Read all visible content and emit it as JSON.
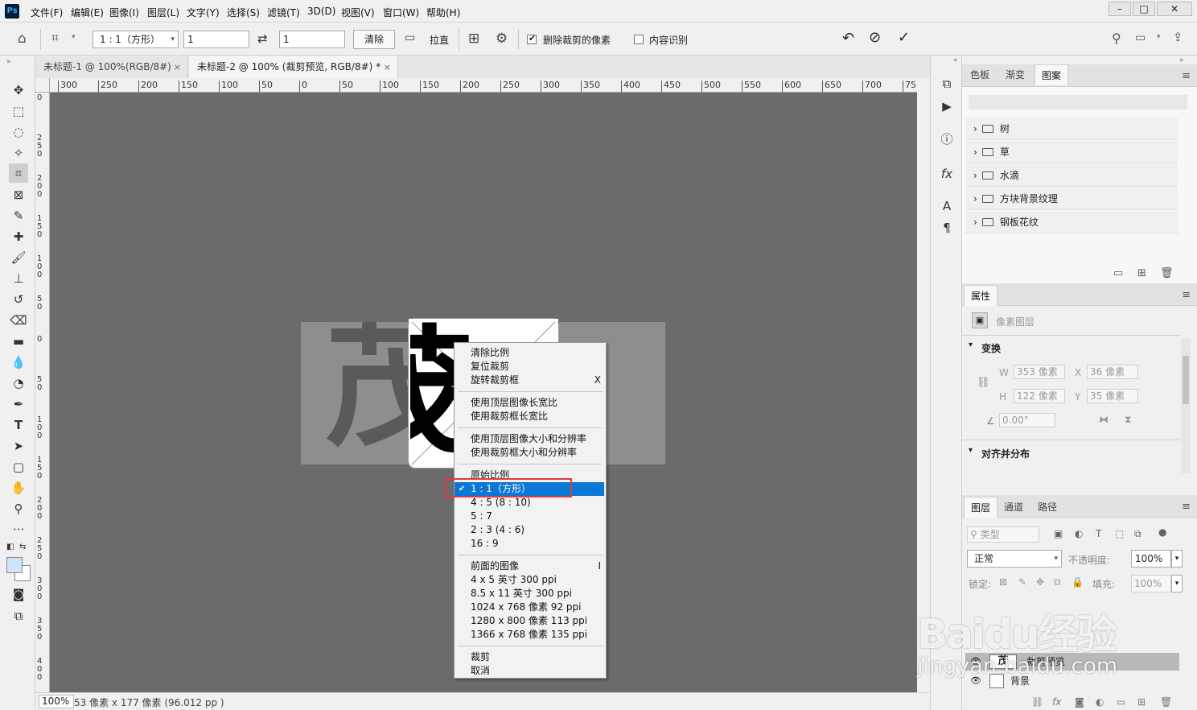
{
  "app": {
    "logo": "Ps"
  },
  "menubar": {
    "items": [
      "文件(F)",
      "编辑(E)",
      "图像(I)",
      "图层(L)",
      "文字(Y)",
      "选择(S)",
      "滤镜(T)",
      "3D(D)",
      "视图(V)",
      "窗口(W)",
      "帮助(H)"
    ]
  },
  "options": {
    "ratio_select": "1 : 1（方形）",
    "width_value": "1",
    "height_value": "1",
    "clear_label": "清除",
    "straighten_label": "拉直",
    "delete_cropped_label": "删除裁剪的像素",
    "delete_cropped_checked": true,
    "content_aware_label": "内容识别",
    "content_aware_checked": false
  },
  "tabs": [
    {
      "label": "未标题-1 @ 100%(RGB/8#)",
      "active": false
    },
    {
      "label": "未标题-2 @ 100% (裁剪预览, RGB/8#) *",
      "active": true
    }
  ],
  "ruler": {
    "h_ticks": [
      "300",
      "250",
      "200",
      "150",
      "100",
      "50",
      "0",
      "50",
      "100",
      "150",
      "200",
      "250",
      "300",
      "350",
      "400",
      "450",
      "500",
      "550",
      "600",
      "650",
      "700",
      "75"
    ],
    "v_ticks": [
      "0",
      "250",
      "200",
      "150",
      "100",
      "50",
      "0",
      "50",
      "100",
      "150",
      "200",
      "250",
      "300",
      "350",
      "400",
      "4"
    ]
  },
  "canvas": {
    "bg_text": "茂",
    "crop_text": "茂"
  },
  "context_menu": {
    "groups": [
      [
        {
          "label": "清除比例"
        },
        {
          "label": "复位裁剪"
        },
        {
          "label": "旋转裁剪框",
          "shortcut": "X"
        }
      ],
      [
        {
          "label": "使用顶层图像长宽比"
        },
        {
          "label": "使用裁剪框长宽比"
        }
      ],
      [
        {
          "label": "使用顶层图像大小和分辨率"
        },
        {
          "label": "使用裁剪框大小和分辨率"
        }
      ],
      [
        {
          "label": "原始比例"
        },
        {
          "label": "1 : 1（方形）",
          "selected": true
        },
        {
          "label": "4 : 5 (8 : 10)"
        },
        {
          "label": "5 : 7"
        },
        {
          "label": "2 : 3 (4 : 6)"
        },
        {
          "label": "16 : 9"
        }
      ],
      [
        {
          "label": "前面的图像",
          "shortcut": "I"
        },
        {
          "label": "4 x 5 英寸 300 ppi"
        },
        {
          "label": "8.5 x 11 英寸 300 ppi"
        },
        {
          "label": "1024 x 768 像素 92 ppi"
        },
        {
          "label": "1280 x 800 像素 113 ppi"
        },
        {
          "label": "1366 x 768 像素 135 ppi"
        }
      ],
      [
        {
          "label": "裁剪"
        },
        {
          "label": "取消"
        }
      ]
    ]
  },
  "status": {
    "zoom": "100%",
    "info": "53 像素 x 177 像素 (96.012 pp )"
  },
  "patterns_panel": {
    "tabs": [
      "色板",
      "渐变",
      "图案"
    ],
    "active_tab": "图案",
    "folders": [
      "树",
      "草",
      "水滴",
      "方块背景纹理",
      "钢板花纹"
    ]
  },
  "properties_panel": {
    "tab": "属性",
    "layer_type": "像素图层",
    "transform_title": "变换",
    "w_label": "W",
    "w_value": "353 像素",
    "h_label": "H",
    "h_value": "122 像素",
    "x_label": "X",
    "x_value": "36 像素",
    "y_label": "Y",
    "y_value": "35 像素",
    "angle_value": "0.00°",
    "align_title": "对齐并分布"
  },
  "layers_panel": {
    "tabs": [
      "图层",
      "通道",
      "路径"
    ],
    "active_tab": "图层",
    "filter_label": "类型",
    "blend_mode": "正常",
    "opacity_label": "不透明度:",
    "opacity_value": "100%",
    "lock_label": "锁定:",
    "fill_label": "填充:",
    "fill_value": "100%",
    "layers": [
      {
        "name": "裁剪预览",
        "thumb": "茂",
        "selected": true
      },
      {
        "name": "背景",
        "thumb": "",
        "selected": false
      }
    ]
  },
  "watermark": {
    "line1": "Baidu经验",
    "line2": "jingyan.baidu.com"
  },
  "colors": {
    "accent": "#0a78d7",
    "canvas": "#6b6b6b",
    "highlight_border": "#e23a3a"
  }
}
